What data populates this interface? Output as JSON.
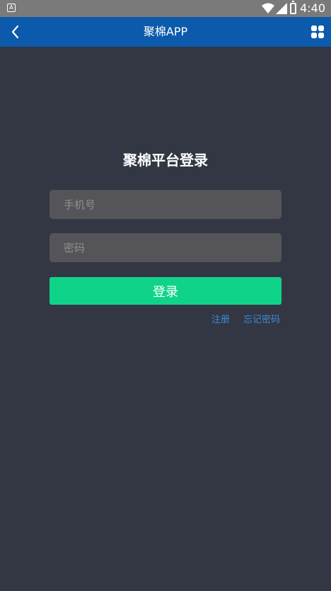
{
  "status_bar": {
    "time": "4:40",
    "app_icon_label": "A"
  },
  "header": {
    "title": "聚棉APP"
  },
  "login": {
    "title": "聚棉平台登录",
    "phone_placeholder": "手机号",
    "password_placeholder": "密码",
    "button_label": "登录",
    "register_link": "注册",
    "forgot_link": "忘记密码"
  },
  "colors": {
    "header_bg": "#0b5aab",
    "page_bg": "#333743",
    "button_bg": "#10d38a",
    "link": "#3d8bd8",
    "field_bg": "#555559"
  }
}
